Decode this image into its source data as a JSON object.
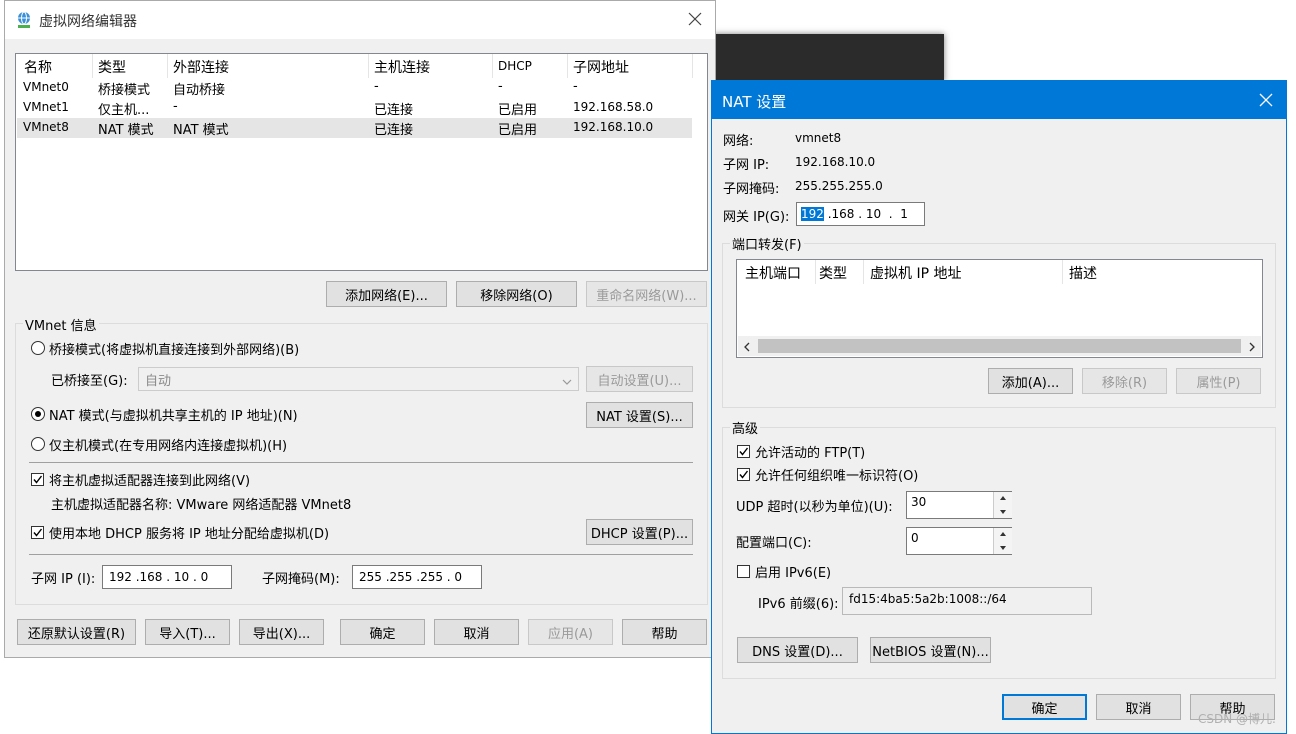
{
  "editor": {
    "title": "虚拟网络编辑器",
    "table": {
      "headers": [
        "名称",
        "类型",
        "外部连接",
        "主机连接",
        "DHCP",
        "子网地址"
      ],
      "rows": [
        [
          "VMnet0",
          "桥接模式",
          "自动桥接",
          "-",
          "-",
          "-"
        ],
        [
          "VMnet1",
          "仅主机...",
          "-",
          "已连接",
          "已启用",
          "192.168.58.0"
        ],
        [
          "VMnet8",
          "NAT 模式",
          "NAT 模式",
          "已连接",
          "已启用",
          "192.168.10.0"
        ]
      ],
      "selected_row": 2
    },
    "buttons": {
      "add_network": "添加网络(E)...",
      "remove_network": "移除网络(O)",
      "rename_network": "重命名网络(W)..."
    },
    "vmnet_info": {
      "title": "VMnet 信息",
      "bridge_radio": "桥接模式(将虚拟机直接连接到外部网络)(B)",
      "bridged_to_label": "已桥接至(G):",
      "bridged_to_value": "自动",
      "auto_settings": "自动设置(U)...",
      "nat_radio": "NAT 模式(与虚拟机共享主机的 IP 地址)(N)",
      "nat_settings": "NAT 设置(S)...",
      "host_only_radio": "仅主机模式(在专用网络内连接虚拟机)(H)",
      "connect_adapter": "将主机虚拟适配器连接到此网络(V)",
      "adapter_name": "主机虚拟适配器名称: VMware 网络适配器 VMnet8",
      "use_dhcp": "使用本地 DHCP 服务将 IP 地址分配给虚拟机(D)",
      "dhcp_settings": "DHCP 设置(P)...",
      "subnet_ip_label": "子网 IP (I):",
      "subnet_ip_value": "192 .168 . 10  .  0",
      "subnet_mask_label": "子网掩码(M):",
      "subnet_mask_value": "255 .255 .255 .  0"
    },
    "footer": {
      "restore": "还原默认设置(R)",
      "import": "导入(T)...",
      "export": "导出(X)...",
      "ok": "确定",
      "cancel": "取消",
      "apply": "应用(A)",
      "help": "帮助"
    }
  },
  "nat": {
    "title": "NAT 设置",
    "network_label": "网络:",
    "network_value": "vmnet8",
    "subnet_ip_label": "子网 IP:",
    "subnet_ip_value": "192.168.10.0",
    "subnet_mask_label": "子网掩码:",
    "subnet_mask_value": "255.255.255.0",
    "gateway_label": "网关 IP(G):",
    "gateway_selected": "192",
    "gateway_rest": " .168 . 10  .  1",
    "port_forwarding": {
      "title": "端口转发(F)",
      "headers": [
        "主机端口",
        "类型",
        "虚拟机 IP 地址",
        "描述"
      ],
      "add": "添加(A)...",
      "remove": "移除(R)",
      "properties": "属性(P)"
    },
    "advanced": {
      "title": "高级",
      "allow_ftp": "允许活动的 FTP(T)",
      "allow_any_oui": "允许任何组织唯一标识符(O)",
      "udp_timeout_label": "UDP 超时(以秒为单位)(U):",
      "udp_timeout_value": "30",
      "config_port_label": "配置端口(C):",
      "config_port_value": "0",
      "enable_ipv6": "启用 IPv6(E)",
      "ipv6_prefix_label": "IPv6 前缀(6):",
      "ipv6_prefix_value": "fd15:4ba5:5a2b:1008::/64",
      "dns_settings": "DNS 设置(D)...",
      "netbios_settings": "NetBIOS 设置(N)..."
    },
    "footer": {
      "ok": "确定",
      "cancel": "取消",
      "help": "帮助"
    }
  },
  "watermark": "CSDN @博儿.",
  "colors": {
    "accent": "#0078d7",
    "selected_row": "#e5e5e5",
    "dialog_bg": "#f0f0f0"
  }
}
